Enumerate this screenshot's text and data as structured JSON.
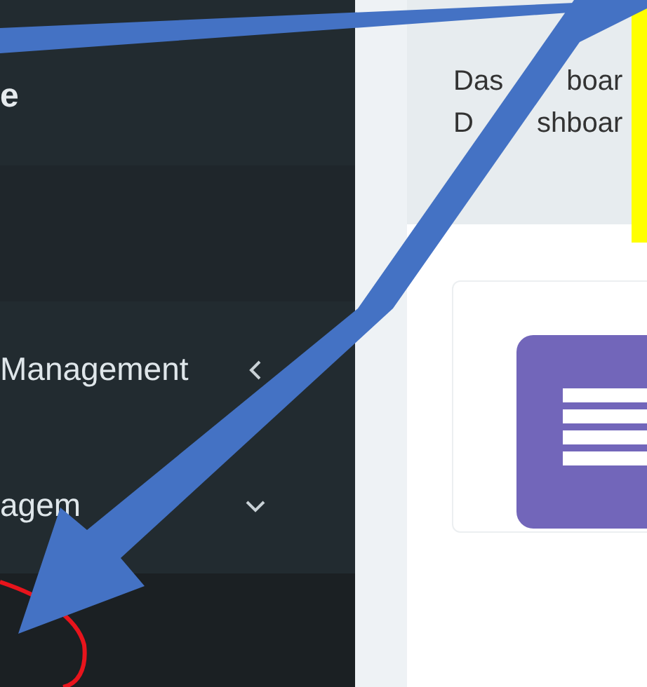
{
  "sidebar": {
    "brand": "e",
    "items": [
      {
        "label": "Management",
        "expanded": false
      },
      {
        "label": "agem",
        "expanded": true
      }
    ]
  },
  "header": {
    "title_parts": [
      "Das",
      "boar"
    ],
    "breadcrumb_parts": [
      "D",
      "shboar"
    ]
  }
}
